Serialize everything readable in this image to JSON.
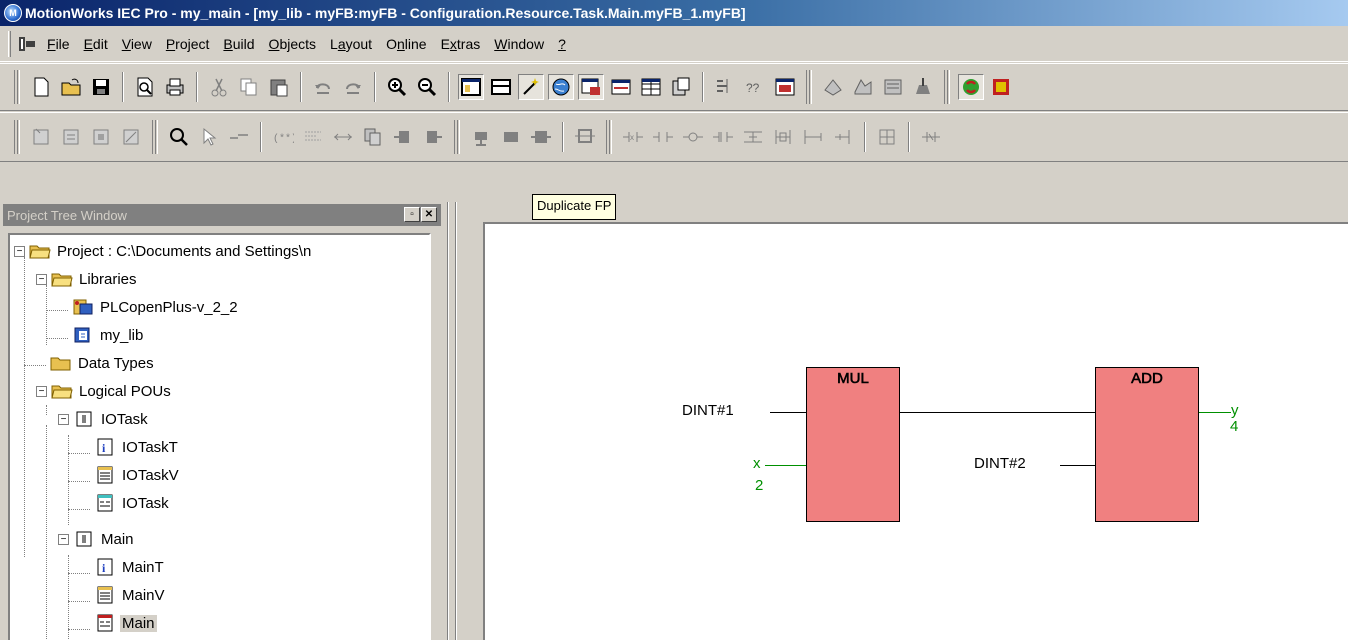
{
  "window": {
    "title": "MotionWorks IEC Pro - my_main - [my_lib - myFB:myFB - Configuration.Resource.Task.Main.myFB_1.myFB]"
  },
  "menu": [
    {
      "pre": "",
      "key": "F",
      "post": "ile"
    },
    {
      "pre": "",
      "key": "E",
      "post": "dit"
    },
    {
      "pre": "",
      "key": "V",
      "post": "iew"
    },
    {
      "pre": "",
      "key": "P",
      "post": "roject"
    },
    {
      "pre": "",
      "key": "B",
      "post": "uild"
    },
    {
      "pre": "",
      "key": "O",
      "post": "bjects"
    },
    {
      "pre": "L",
      "key": "a",
      "post": "yout"
    },
    {
      "pre": "O",
      "key": "n",
      "post": "line"
    },
    {
      "pre": "E",
      "key": "x",
      "post": "tras"
    },
    {
      "pre": "",
      "key": "W",
      "post": "indow"
    },
    {
      "pre": "",
      "key": "?",
      "post": ""
    }
  ],
  "tooltip": "Duplicate FP",
  "project_tree": {
    "title": "Project Tree Window",
    "nodes": {
      "project": "Project : C:\\Documents and Settings\\n",
      "libraries": "Libraries",
      "plcopen": "PLCopenPlus-v_2_2",
      "my_lib": "my_lib",
      "data_types": "Data Types",
      "logical_pous": "Logical POUs",
      "iotask": "IOTask",
      "iotaskt": "IOTaskT",
      "iotaskv": "IOTaskV",
      "iotask_code": "IOTask",
      "main": "Main",
      "maint": "MainT",
      "mainv": "MainV",
      "main_code": "Main"
    }
  },
  "diagram": {
    "mul": {
      "name": "MUL",
      "in1": "DINT#1",
      "in2_var": "x",
      "in2_val": "2"
    },
    "add": {
      "name": "ADD",
      "in2": "DINT#2",
      "out_var": "y",
      "out_val": "4"
    }
  },
  "colors": {
    "fb_fill": "#f08080",
    "online_value": "#009000",
    "title_start": "#0a246a",
    "title_end": "#a6caf0"
  }
}
